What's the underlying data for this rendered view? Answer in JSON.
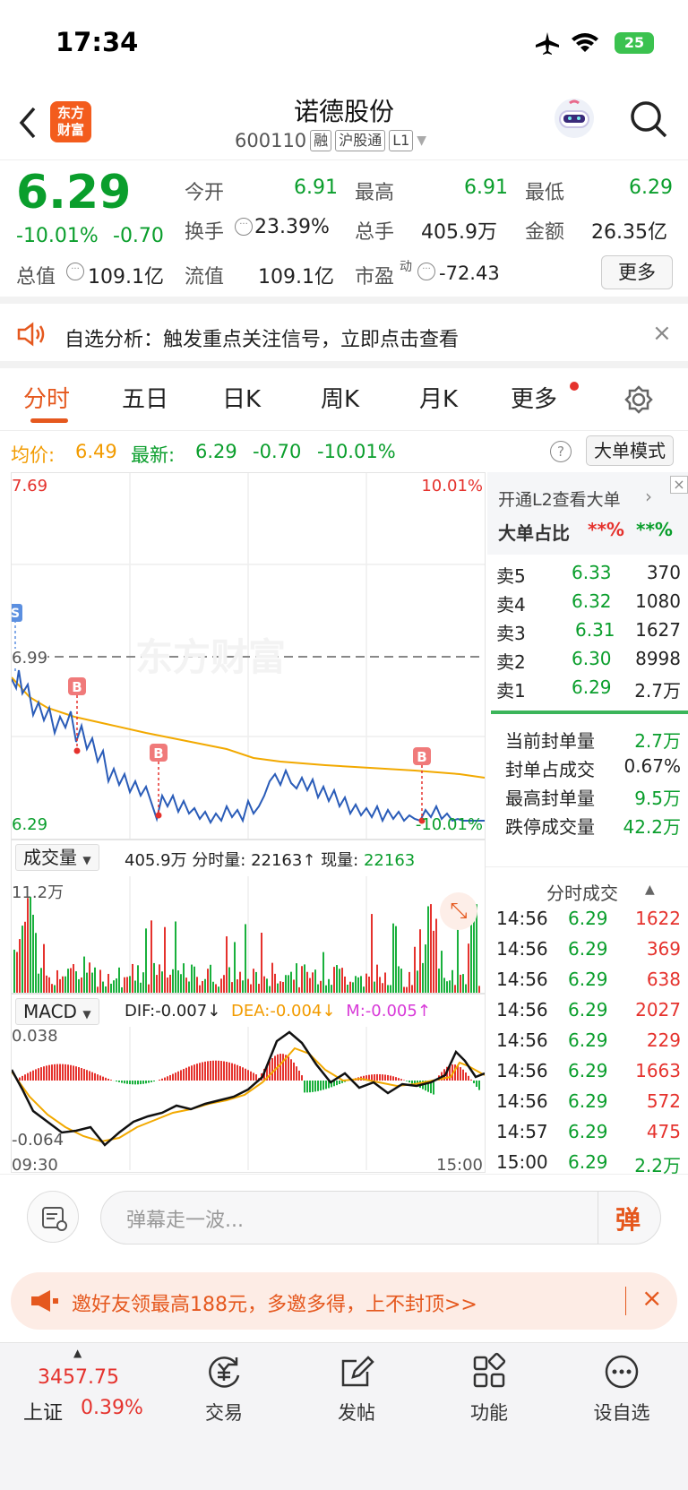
{
  "status": {
    "time": "17:34",
    "battery": "25"
  },
  "header": {
    "logo_text": "东方\n财富",
    "title": "诺德股份",
    "code": "600110",
    "tags": [
      "融",
      "沪股通",
      "L1"
    ]
  },
  "quote": {
    "price": "6.29",
    "change_pct": "-10.01%",
    "change": "-0.70",
    "open_label": "今开",
    "open": "6.91",
    "high_label": "最高",
    "high": "6.91",
    "low_label": "最低",
    "low": "6.29",
    "turnover_label": "换手",
    "turnover": "23.39%",
    "volume_label": "总手",
    "volume": "405.9万",
    "amount_label": "金额",
    "amount": "26.35亿",
    "mktcap_label": "总值",
    "mktcap": "109.1亿",
    "float_label": "流值",
    "float": "109.1亿",
    "pe_label": "市盈",
    "pe_sup": "动",
    "pe": "-72.43",
    "more": "更多"
  },
  "notice": {
    "text": "自选分析：触发重点关注信号，立即点击查看"
  },
  "tabs": [
    "分时",
    "五日",
    "日K",
    "周K",
    "月K",
    "更多"
  ],
  "infobar": {
    "avg_label": "均价:",
    "avg": "6.49",
    "latest_label": "最新:",
    "latest": "6.29",
    "chg": "-0.70",
    "pct": "-10.01%",
    "mode": "大单模式"
  },
  "chart": {
    "y_top": "7.69",
    "y_bottom": "6.29",
    "pct_top": "10.01%",
    "pct_bottom": "-10.01%",
    "prev_close": "6.99",
    "watermark": "东方财富",
    "marker_s": "S",
    "marker_b": "B"
  },
  "volume": {
    "selector": "成交量",
    "total": "405.9万",
    "fenshi_label": "分时量:",
    "fenshi": "22163",
    "xianliang_label": "现量:",
    "xianliang": "22163",
    "max": "11.2万"
  },
  "macd": {
    "selector": "MACD",
    "dif": "DIF:-0.007",
    "dea": "DEA:-0.004",
    "m": "M:-0.005",
    "top": "0.038",
    "bottom": "-0.064",
    "time_start": "09:30",
    "time_end": "15:00"
  },
  "side": {
    "l2_text": "开通L2查看大单",
    "bigratio_label": "大单占比",
    "ratio1": "**%",
    "ratio2": "**%",
    "asks": [
      {
        "label": "卖5",
        "price": "6.33",
        "vol": "370"
      },
      {
        "label": "卖4",
        "price": "6.32",
        "vol": "1080"
      },
      {
        "label": "卖3",
        "price": "6.31",
        "vol": "1627"
      },
      {
        "label": "卖2",
        "price": "6.30",
        "vol": "8998"
      },
      {
        "label": "卖1",
        "price": "6.29",
        "vol": "2.7万"
      }
    ],
    "stats": [
      {
        "label": "当前封单量",
        "value": "2.7万"
      },
      {
        "label": "封单占成交",
        "value": "0.67%"
      },
      {
        "label": "最高封单量",
        "value": "9.5万"
      },
      {
        "label": "跌停成交量",
        "value": "42.2万"
      }
    ],
    "ticks_title": "分时成交",
    "ticks": [
      {
        "t": "14:56",
        "p": "6.29",
        "v": "1622"
      },
      {
        "t": "14:56",
        "p": "6.29",
        "v": "369"
      },
      {
        "t": "14:56",
        "p": "6.29",
        "v": "638"
      },
      {
        "t": "14:56",
        "p": "6.29",
        "v": "2027"
      },
      {
        "t": "14:56",
        "p": "6.29",
        "v": "229"
      },
      {
        "t": "14:56",
        "p": "6.29",
        "v": "1663"
      },
      {
        "t": "14:56",
        "p": "6.29",
        "v": "572"
      },
      {
        "t": "14:57",
        "p": "6.29",
        "v": "475"
      },
      {
        "t": "15:00",
        "p": "6.29",
        "v": "2.2万"
      }
    ]
  },
  "comment": {
    "placeholder": "弹幕走一波...",
    "send": "弹"
  },
  "promo": {
    "text": "邀好友领最高188元，多邀多得，上不封顶>>"
  },
  "nav": {
    "index_value": "3457.75",
    "index_name": "上证",
    "index_pct": "0.39%",
    "items": [
      "交易",
      "发帖",
      "功能",
      "设自选"
    ]
  },
  "colors": {
    "up": "#e5322d",
    "down": "#0a9e2c",
    "avg_line": "#f2a900",
    "price_line": "#2a5cb8",
    "brand": "#f35c1d"
  }
}
